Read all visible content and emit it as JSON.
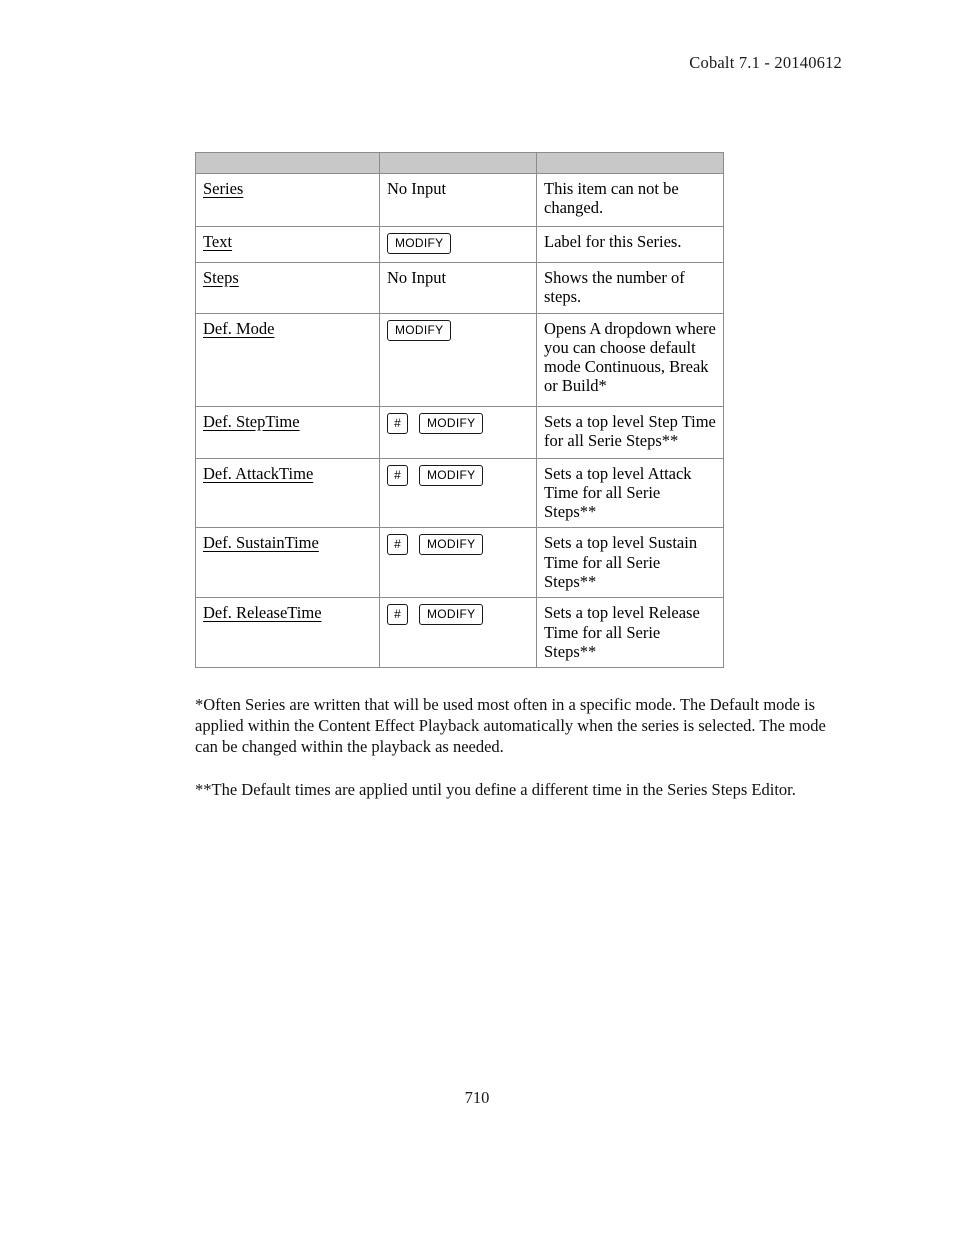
{
  "header": {
    "running_head": "Cobalt 7.1 - 20140612"
  },
  "table": {
    "columns": [
      "",
      "",
      ""
    ],
    "rows": [
      {
        "term": "Series",
        "input_type": "text",
        "input_text": "No Input",
        "buttons": [],
        "description": "This item can not be changed."
      },
      {
        "term": "Text",
        "input_type": "buttons",
        "input_text": "",
        "buttons": [
          "MODIFY"
        ],
        "description": "Label for this Series."
      },
      {
        "term": "Steps",
        "input_type": "text",
        "input_text": "No Input",
        "buttons": [],
        "description": "Shows the number of steps."
      },
      {
        "term": "Def. Mode",
        "input_type": "buttons",
        "input_text": "",
        "buttons": [
          "MODIFY"
        ],
        "description": "Opens A dropdown where you can choose default mode Continuous, Break or Build*"
      },
      {
        "term": "Def. StepTime",
        "input_type": "buttons",
        "input_text": "",
        "buttons": [
          "#",
          "MODIFY"
        ],
        "description": "Sets a top level Step Time for all Serie Steps**"
      },
      {
        "term": "Def. AttackTime",
        "input_type": "buttons",
        "input_text": "",
        "buttons": [
          "#",
          "MODIFY"
        ],
        "description": "Sets a top level Attack Time for all Serie Steps**"
      },
      {
        "term": "Def. SustainTime",
        "input_type": "buttons",
        "input_text": "",
        "buttons": [
          "#",
          "MODIFY"
        ],
        "description": "Sets a top level Sustain Time for all Serie Steps**"
      },
      {
        "term": "Def. ReleaseTime",
        "input_type": "buttons",
        "input_text": "",
        "buttons": [
          "#",
          "MODIFY"
        ],
        "description": "Sets a top level Release Time for all Serie Steps**"
      }
    ]
  },
  "footnotes": {
    "first": "*Often Series are written that will be used most often in a specific mode. The Default mode is applied within the Content Effect Playback automatically when the series is selected. The mode can be changed within the playback as needed.",
    "second": "**The Default times are applied until you define a different time in the Series Steps Editor."
  },
  "page_number": "710",
  "colors": {
    "header_row_fill": "#c8c8c8",
    "border": "#8c8c8c",
    "text": "#000000"
  }
}
